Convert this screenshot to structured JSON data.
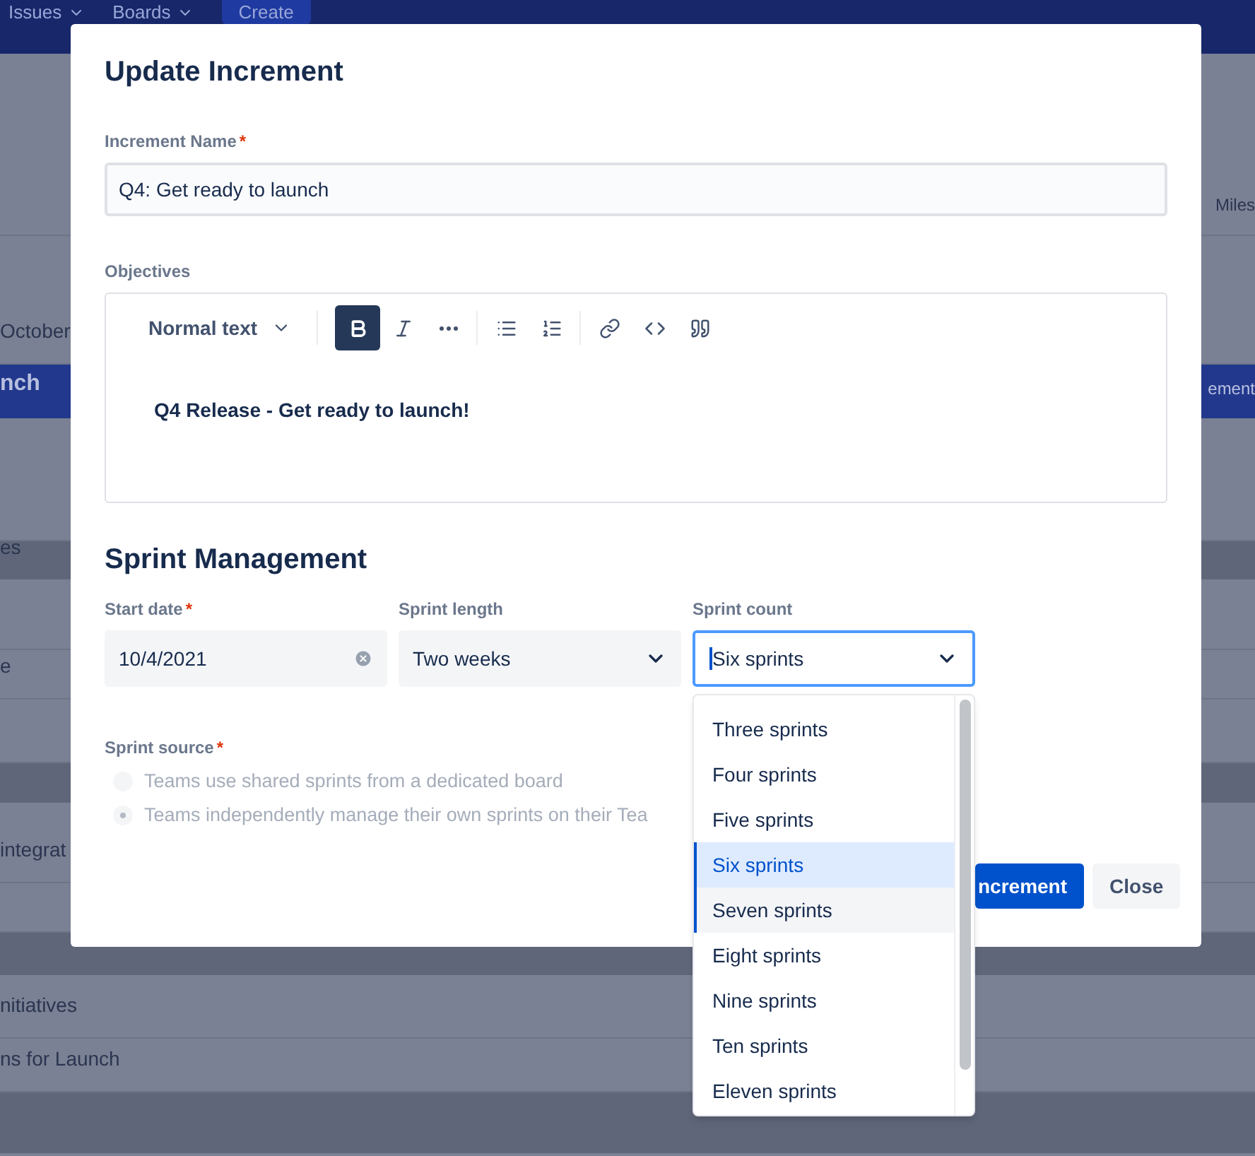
{
  "background": {
    "nav": [
      {
        "label": "Issues",
        "kind": "menu"
      },
      {
        "label": "Boards",
        "kind": "menu"
      },
      {
        "label": "Create",
        "kind": "button"
      }
    ],
    "rows": [
      {
        "kind": "plain",
        "left": "",
        "right": "Miles"
      },
      {
        "kind": "plain",
        "left": "October",
        "right": ""
      },
      {
        "kind": "highlight",
        "left": "nch",
        "right": "ement"
      },
      {
        "kind": "plain",
        "left": "",
        "right": ""
      },
      {
        "kind": "header",
        "left": "es",
        "right": ""
      },
      {
        "kind": "plain",
        "left": "",
        "right": ""
      },
      {
        "kind": "plain",
        "left": "e",
        "right": ""
      },
      {
        "kind": "plain",
        "left": "",
        "right": ""
      },
      {
        "kind": "header",
        "left": "",
        "right": ""
      },
      {
        "kind": "plain",
        "left": "integrat",
        "right": ""
      },
      {
        "kind": "plain",
        "left": "",
        "right": ""
      },
      {
        "kind": "header",
        "left": "",
        "right": ""
      },
      {
        "kind": "plain",
        "left": "nitiatives",
        "right": ""
      },
      {
        "kind": "plain",
        "left": "ns for Launch",
        "right": ""
      },
      {
        "kind": "header",
        "left": "",
        "right": ""
      }
    ]
  },
  "dialog": {
    "title": "Update Increment",
    "required_mark": "*",
    "increment_name": {
      "label": "Increment Name",
      "required": true,
      "value": "Q4: Get ready to launch"
    },
    "objectives": {
      "label": "Objectives",
      "text_style": "Normal text",
      "tools": [
        {
          "kind": "bold",
          "active": true
        },
        {
          "kind": "italic",
          "active": false
        },
        {
          "kind": "more",
          "active": false
        },
        {
          "kind": "bullets",
          "active": false
        },
        {
          "kind": "numbers",
          "active": false
        },
        {
          "kind": "link",
          "active": false
        },
        {
          "kind": "code",
          "active": false
        },
        {
          "kind": "quote",
          "active": false
        }
      ],
      "content": "Q4 Release - Get ready to launch!"
    },
    "section_title": "Sprint Management",
    "fields": [
      {
        "kind": "date",
        "label": "Start date",
        "required": true,
        "value": "10/4/2021",
        "focused": false
      },
      {
        "kind": "select",
        "label": "Sprint length",
        "required": false,
        "value": "Two weeks",
        "focused": false
      },
      {
        "kind": "select",
        "label": "Sprint count",
        "required": false,
        "value": "Six sprints",
        "focused": true
      }
    ],
    "sprint_source": {
      "label": "Sprint source",
      "required": true,
      "disabled": true,
      "options": [
        {
          "label": "Teams use shared sprints from a dedicated board",
          "selected": false
        },
        {
          "label": "Teams independently manage their own sprints on their Tea",
          "selected": true
        }
      ]
    },
    "buttons": [
      {
        "label": "ncrement",
        "kind": "primary"
      },
      {
        "label": "Close",
        "kind": "secondary"
      }
    ]
  },
  "dropdown": {
    "options": [
      {
        "label": "Three sprints",
        "selected": false,
        "focused": false
      },
      {
        "label": "Four sprints",
        "selected": false,
        "focused": false
      },
      {
        "label": "Five sprints",
        "selected": false,
        "focused": false
      },
      {
        "label": "Six sprints",
        "selected": true,
        "focused": false
      },
      {
        "label": "Seven sprints",
        "selected": false,
        "focused": true
      },
      {
        "label": "Eight sprints",
        "selected": false,
        "focused": false
      },
      {
        "label": "Nine sprints",
        "selected": false,
        "focused": false
      },
      {
        "label": "Ten sprints",
        "selected": false,
        "focused": false
      },
      {
        "label": "Eleven sprints",
        "selected": false,
        "focused": false
      }
    ]
  }
}
